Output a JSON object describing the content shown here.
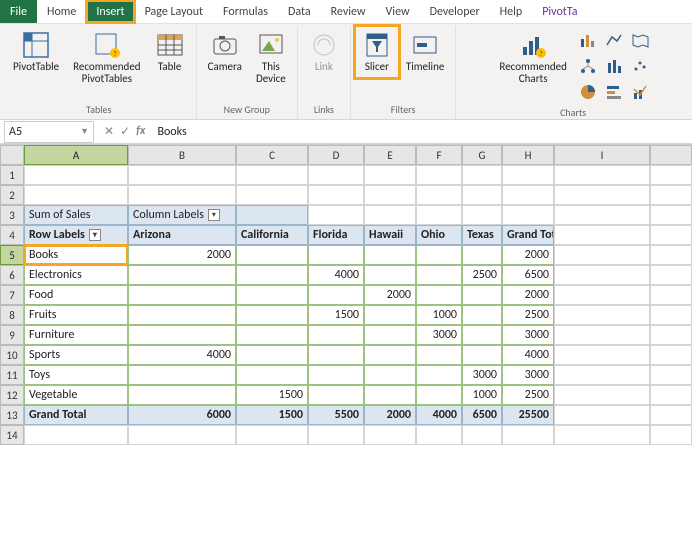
{
  "tabs": {
    "file": "File",
    "home": "Home",
    "insert": "Insert",
    "pageLayout": "Page Layout",
    "formulas": "Formulas",
    "data": "Data",
    "review": "Review",
    "view": "View",
    "developer": "Developer",
    "help": "Help",
    "pivot": "PivotTa"
  },
  "ribbon": {
    "group_tables": "Tables",
    "group_newgroup": "New Group",
    "group_links": "Links",
    "group_filters": "Filters",
    "group_charts": "Charts",
    "pivotTable": "PivotTable",
    "recPivot": "Recommended\nPivotTables",
    "table": "Table",
    "camera": "Camera",
    "thisDevice": "This\nDevice",
    "link": "Link",
    "slicer": "Slicer",
    "timeline": "Timeline",
    "recCharts": "Recommended\nCharts"
  },
  "namebox": "A5",
  "formula": "Books",
  "columns": [
    "A",
    "B",
    "C",
    "D",
    "E",
    "F",
    "G",
    "H",
    "I"
  ],
  "rows": [
    "1",
    "2",
    "3",
    "4",
    "5",
    "6",
    "7",
    "8",
    "9",
    "10",
    "11",
    "12",
    "13",
    "14"
  ],
  "pivot": {
    "sumOfSales": "Sum of Sales",
    "columnLabels": "Column Labels",
    "rowLabels": "Row Labels",
    "states": {
      "arizona": "Arizona",
      "california": "California",
      "florida": "Florida",
      "hawaii": "Hawaii",
      "ohio": "Ohio",
      "texas": "Texas",
      "grandTotal": "Grand Total"
    },
    "cats": {
      "books": "Books",
      "electronics": "Electronics",
      "food": "Food",
      "fruits": "Fruits",
      "furniture": "Furniture",
      "sports": "Sports",
      "toys": "Toys",
      "vegetable": "Vegetable",
      "grandTotal": "Grand Total"
    },
    "vals": {
      "books": {
        "arizona": "2000",
        "grand": "2000"
      },
      "electronics": {
        "florida": "4000",
        "texas": "2500",
        "grand": "6500"
      },
      "food": {
        "hawaii": "2000",
        "grand": "2000"
      },
      "fruits": {
        "florida": "1500",
        "ohio": "1000",
        "grand": "2500"
      },
      "furniture": {
        "ohio": "3000",
        "grand": "3000"
      },
      "sports": {
        "arizona": "4000",
        "grand": "4000"
      },
      "toys": {
        "texas": "3000",
        "grand": "3000"
      },
      "vegetable": {
        "california": "1500",
        "texas": "1000",
        "grand": "2500"
      },
      "grand": {
        "arizona": "6000",
        "california": "1500",
        "florida": "5500",
        "hawaii": "2000",
        "ohio": "4000",
        "texas": "6500",
        "grand": "25500"
      }
    }
  }
}
